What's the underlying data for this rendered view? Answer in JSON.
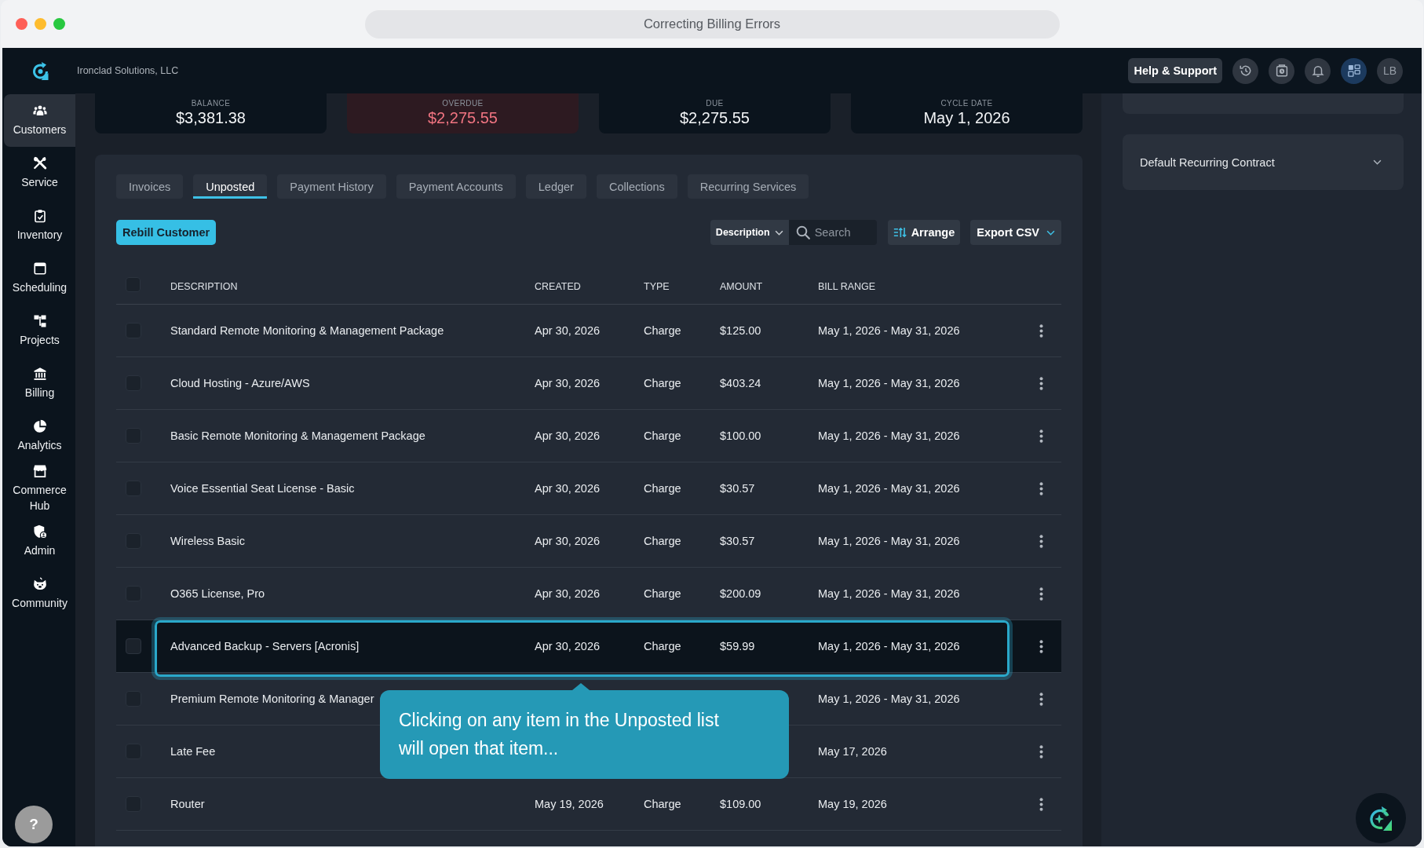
{
  "window": {
    "title": "Correcting Billing Errors"
  },
  "top_bar": {
    "company": "Ironclad Solutions, LLC",
    "help_button": "Help & Support",
    "icon_buttons": [
      {
        "selected": false
      },
      {
        "selected": false
      },
      {
        "selected": false
      },
      {
        "selected": true
      }
    ],
    "avatar": "LB"
  },
  "sidebar": {
    "items": [
      {
        "label": "Customers",
        "selected": true
      },
      {
        "label": "Service",
        "selected": false
      },
      {
        "label": "Inventory",
        "selected": false
      },
      {
        "label": "Scheduling",
        "selected": false
      },
      {
        "label": "Projects",
        "selected": false
      },
      {
        "label": "Billing",
        "selected": false
      },
      {
        "label": "Analytics",
        "selected": false
      },
      {
        "label": "Commerce Hub",
        "selected": false
      },
      {
        "label": "Admin",
        "selected": false
      },
      {
        "label": "Community",
        "selected": false
      }
    ],
    "help_button": "?"
  },
  "summary": {
    "cards": [
      {
        "label": "BALANCE",
        "value": "$3,381.38",
        "alert": false
      },
      {
        "label": "OVERDUE",
        "value": "$2,275.55",
        "alert": true
      },
      {
        "label": "DUE",
        "value": "$2,275.55",
        "alert": false
      },
      {
        "label": "CYCLE DATE",
        "value": "May 1, 2026",
        "alert": false
      }
    ]
  },
  "tabs": [
    {
      "label": "Invoices",
      "selected": false
    },
    {
      "label": "Unposted",
      "selected": true
    },
    {
      "label": "Payment History",
      "selected": false
    },
    {
      "label": "Payment Accounts",
      "selected": false
    },
    {
      "label": "Ledger",
      "selected": false
    },
    {
      "label": "Collections",
      "selected": false
    },
    {
      "label": "Recurring Services",
      "selected": false
    }
  ],
  "toolbar": {
    "rebill_button": "Rebill Customer",
    "filter_dropdown": "Description",
    "search": {
      "placeholder": "Search"
    },
    "arrange_button": "Arrange",
    "export_button": "Export CSV"
  },
  "table": {
    "header_checkbox": {
      "checked": false
    },
    "columns": [
      "DESCRIPTION",
      "CREATED",
      "TYPE",
      "AMOUNT",
      "BILL RANGE"
    ],
    "rows": [
      {
        "checked": false,
        "highlighted": false,
        "description": "Standard Remote Monitoring & Management Package",
        "created": "Apr 30, 2026",
        "type": "Charge",
        "amount": "$125.00",
        "bill_range": "May 1, 2026 - May 31, 2026"
      },
      {
        "checked": false,
        "highlighted": false,
        "description": "Cloud Hosting - Azure/AWS",
        "created": "Apr 30, 2026",
        "type": "Charge",
        "amount": "$403.24",
        "bill_range": "May 1, 2026 - May 31, 2026"
      },
      {
        "checked": false,
        "highlighted": false,
        "description": "Basic Remote Monitoring & Management Package",
        "created": "Apr 30, 2026",
        "type": "Charge",
        "amount": "$100.00",
        "bill_range": "May 1, 2026 - May 31, 2026"
      },
      {
        "checked": false,
        "highlighted": false,
        "description": "Voice Essential Seat License - Basic",
        "created": "Apr 30, 2026",
        "type": "Charge",
        "amount": "$30.57",
        "bill_range": "May 1, 2026 - May 31, 2026"
      },
      {
        "checked": false,
        "highlighted": false,
        "description": "Wireless Basic",
        "created": "Apr 30, 2026",
        "type": "Charge",
        "amount": "$30.57",
        "bill_range": "May 1, 2026 - May 31, 2026"
      },
      {
        "checked": false,
        "highlighted": false,
        "description": "O365 License, Pro",
        "created": "Apr 30, 2026",
        "type": "Charge",
        "amount": "$200.09",
        "bill_range": "May 1, 2026 - May 31, 2026"
      },
      {
        "checked": false,
        "highlighted": true,
        "description": "Advanced Backup - Servers [Acronis]",
        "created": "Apr 30, 2026",
        "type": "Charge",
        "amount": "$59.99",
        "bill_range": "May 1, 2026 - May 31, 2026"
      },
      {
        "checked": false,
        "highlighted": false,
        "description": "Premium Remote Monitoring & Manager",
        "bill_range": "May 1, 2026 - May 31, 2026"
      },
      {
        "checked": false,
        "highlighted": false,
        "description": "Late Fee",
        "bill_range": "May 17, 2026"
      },
      {
        "checked": false,
        "highlighted": false,
        "description": "Router",
        "created": "May 19, 2026",
        "type": "Charge",
        "amount": "$109.00",
        "bill_range": "May 19, 2026"
      }
    ]
  },
  "tour_tooltip": {
    "text": "Clicking on any item in the Unposted list will open that item..."
  },
  "side_panel": {
    "contract_dropdown": {
      "label": "Default Recurring Contract",
      "expanded": false
    }
  }
}
